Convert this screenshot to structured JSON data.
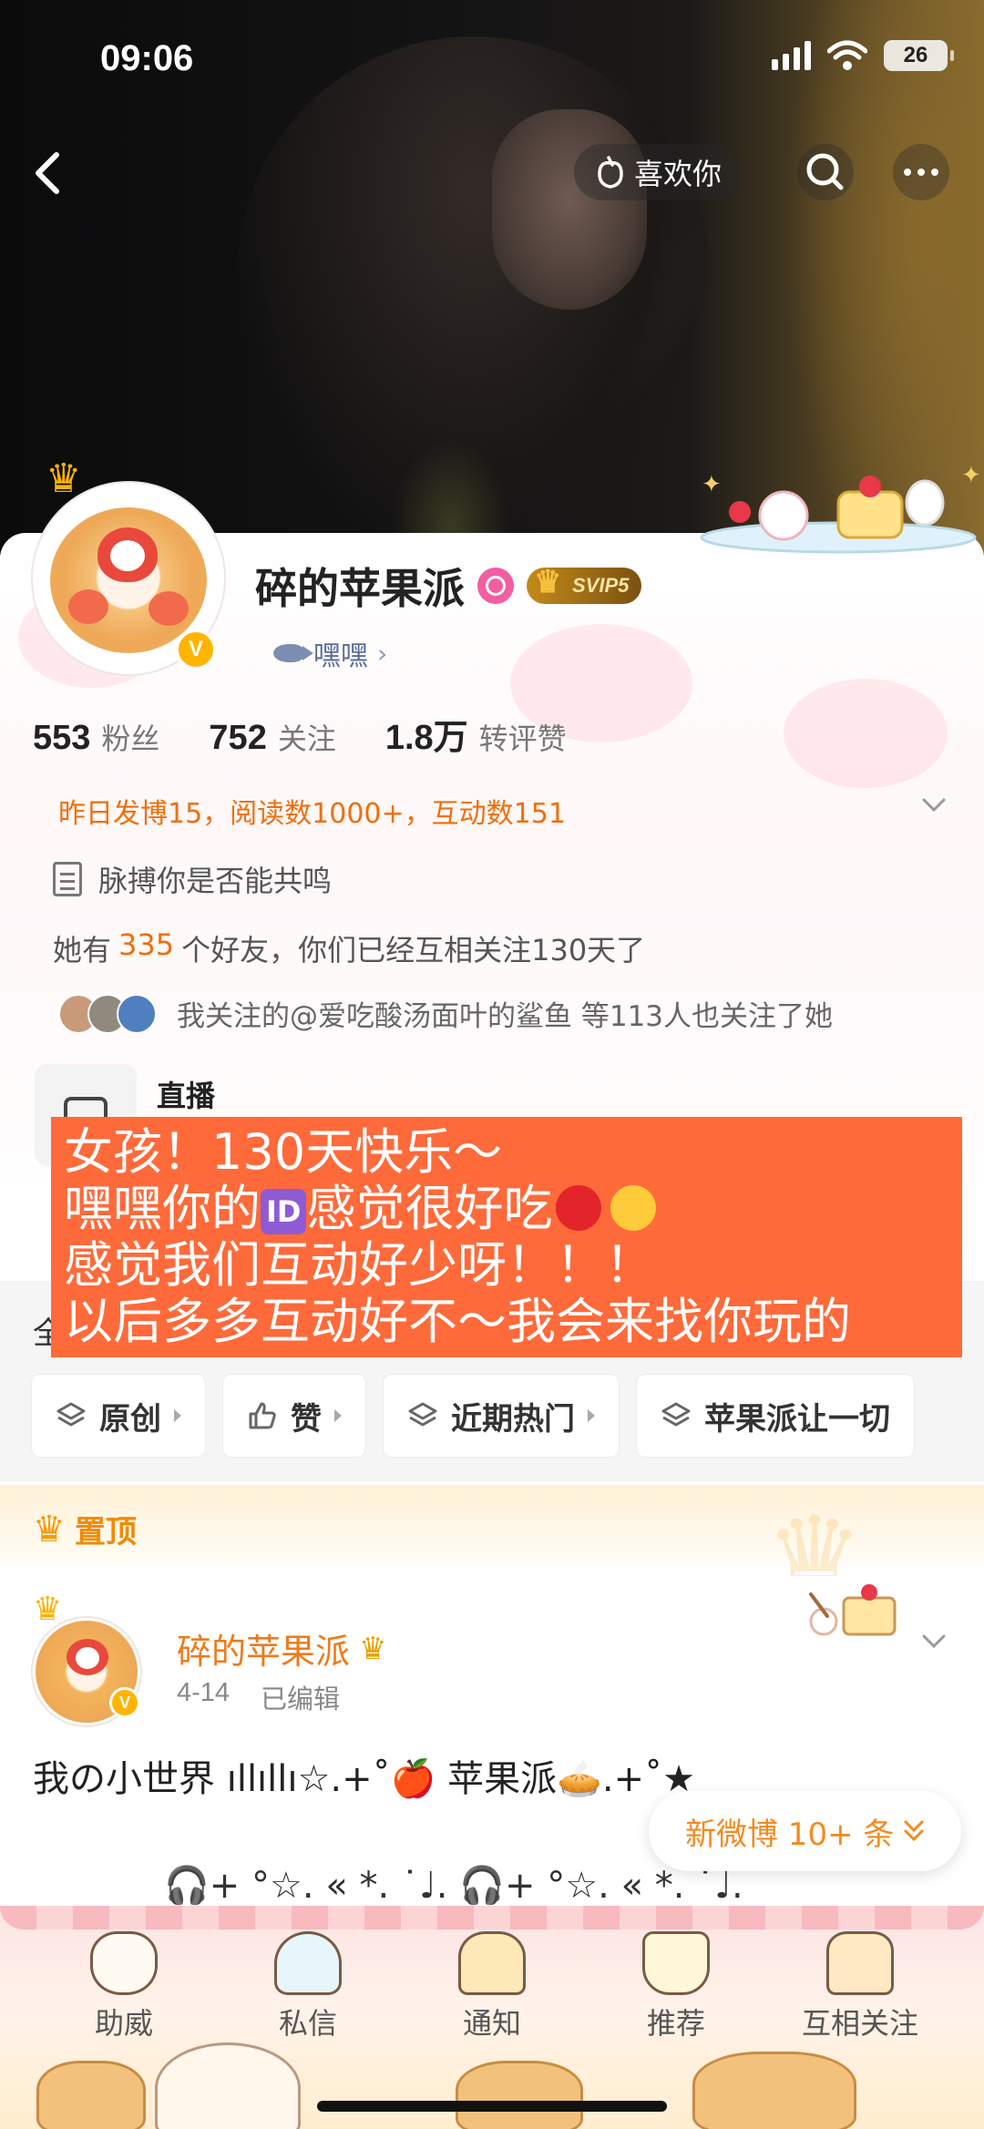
{
  "status_bar": {
    "time": "09:06",
    "battery": "26"
  },
  "top_nav": {
    "like_label": "喜欢你"
  },
  "profile": {
    "name": "碎的苹果派",
    "vip_badge": "SVIP5",
    "tag": "嘿嘿",
    "stats": [
      {
        "num": "553",
        "label": "粉丝"
      },
      {
        "num": "752",
        "label": "关注"
      },
      {
        "num": "1.8万",
        "label": "转评赞"
      }
    ],
    "yesterday_summary": "昨日发博15，阅读数1000+，互动数151",
    "bio": "脉搏你是否能共鸣",
    "friends_prefix": "她有",
    "friends_count": "335",
    "friends_suffix": "个好友，你们已经互相关注130天了",
    "mutual_text": "我关注的@爱吃酸汤面叶的鲨鱼  等113人也关注了她",
    "live_label": "直播"
  },
  "overlay": {
    "line1": "女孩！130天快乐～",
    "line2_a": "嘿嘿你的",
    "line2_id": "ID",
    "line2_b": "感觉很好吃",
    "line3": "感觉我们互动好少呀！！！",
    "line4": "以后多多互动好不～我会来找你玩的"
  },
  "filters": {
    "all_label": "全",
    "chips": [
      "原创",
      "赞",
      "近期热门",
      "苹果派让一切"
    ]
  },
  "pinned": {
    "label": "置顶",
    "post": {
      "author": "碎的苹果派",
      "date": "4-14",
      "edited": "已编辑",
      "text": "我の小世界 ıllıllı☆.+˚🍎 苹果派🥧.+˚★",
      "text2": "🎧+ °☆. « *. ˙♩. 🎧+ °☆. « *. ˙♩."
    }
  },
  "new_weibo": "新微博 10+ 条",
  "tabbar": {
    "items": [
      "助威",
      "私信",
      "通知",
      "推荐",
      "互相关注"
    ]
  },
  "colors": {
    "accent_orange": "#f06e0a",
    "overlay_bg": "#ff6a3a",
    "vip_gold": "#c38a1a"
  }
}
